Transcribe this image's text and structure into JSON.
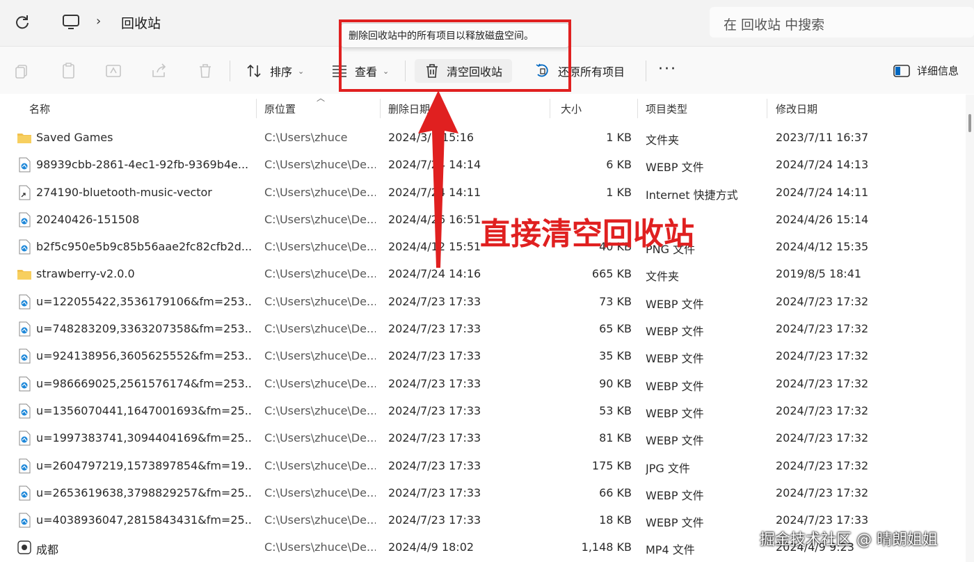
{
  "address": {
    "crumb_sep": "›",
    "crumb": "回收站",
    "search_placeholder": "在 回收站 中搜索"
  },
  "toolbar": {
    "sort_label": "排序",
    "view_label": "查看",
    "empty_label": "清空回收站",
    "restore_all_label": "还原所有项目",
    "more_label": "···",
    "details_label": "详细信息",
    "tooltip": "删除回收站中的所有项目以释放磁盘空间。",
    "caret": "⌄"
  },
  "columns": {
    "name": "名称",
    "location": "原位置",
    "deleted": "删除日期",
    "size": "大小",
    "type": "项目类型",
    "modified": "修改日期"
  },
  "rows": [
    {
      "icon": "folder",
      "name": "Saved Games",
      "location": "C:\\Users\\zhuce",
      "deleted": "2024/3/1 15:16",
      "size": "1 KB",
      "type": "文件夹",
      "modified": "2023/7/11 16:37"
    },
    {
      "icon": "image",
      "name": "98939cbb-2861-4ec1-92fb-9369b4e...",
      "location": "C:\\Users\\zhuce\\De...",
      "deleted": "2024/7/24 14:14",
      "size": "6 KB",
      "type": "WEBP 文件",
      "modified": "2024/7/24 14:13"
    },
    {
      "icon": "shortcut",
      "name": "274190-bluetooth-music-vector",
      "location": "C:\\Users\\zhuce\\De...",
      "deleted": "2024/7/24 14:11",
      "size": "1 KB",
      "type": "Internet 快捷方式",
      "modified": "2024/7/24 14:11"
    },
    {
      "icon": "image",
      "name": "20240426-151508",
      "location": "C:\\Users\\zhuce\\De...",
      "deleted": "2024/4/26 16:51",
      "size": "",
      "type": "",
      "modified": "2024/4/26 15:14"
    },
    {
      "icon": "image",
      "name": "b2f5c950e5b9c85b56aae2fc82cfb2d...",
      "location": "C:\\Users\\zhuce\\De...",
      "deleted": "2024/4/12 15:51",
      "size": "40 KB",
      "type": "PNG 文件",
      "modified": "2024/4/12 15:35"
    },
    {
      "icon": "folder",
      "name": "strawberry-v2.0.0",
      "location": "C:\\Users\\zhuce\\De...",
      "deleted": "2024/7/24 14:16",
      "size": "665 KB",
      "type": "文件夹",
      "modified": "2019/8/5 18:41"
    },
    {
      "icon": "image",
      "name": "u=122055422,3536179106&fm=253...",
      "location": "C:\\Users\\zhuce\\De...",
      "deleted": "2024/7/23 17:33",
      "size": "73 KB",
      "type": "WEBP 文件",
      "modified": "2024/7/23 17:32"
    },
    {
      "icon": "image",
      "name": "u=748283209,3363207358&fm=253...",
      "location": "C:\\Users\\zhuce\\De...",
      "deleted": "2024/7/23 17:33",
      "size": "65 KB",
      "type": "WEBP 文件",
      "modified": "2024/7/23 17:32"
    },
    {
      "icon": "image",
      "name": "u=924138956,3605625552&fm=253...",
      "location": "C:\\Users\\zhuce\\De...",
      "deleted": "2024/7/23 17:33",
      "size": "35 KB",
      "type": "WEBP 文件",
      "modified": "2024/7/23 17:32"
    },
    {
      "icon": "image",
      "name": "u=986669025,2561576174&fm=253...",
      "location": "C:\\Users\\zhuce\\De...",
      "deleted": "2024/7/23 17:33",
      "size": "90 KB",
      "type": "WEBP 文件",
      "modified": "2024/7/23 17:32"
    },
    {
      "icon": "image",
      "name": "u=1356070441,1647001693&fm=25...",
      "location": "C:\\Users\\zhuce\\De...",
      "deleted": "2024/7/23 17:33",
      "size": "53 KB",
      "type": "WEBP 文件",
      "modified": "2024/7/23 17:32"
    },
    {
      "icon": "image",
      "name": "u=1997383741,3094404169&fm=25...",
      "location": "C:\\Users\\zhuce\\De...",
      "deleted": "2024/7/23 17:33",
      "size": "81 KB",
      "type": "WEBP 文件",
      "modified": "2024/7/23 17:32"
    },
    {
      "icon": "image",
      "name": "u=2604797219,1573897854&fm=19...",
      "location": "C:\\Users\\zhuce\\De...",
      "deleted": "2024/7/23 17:33",
      "size": "175 KB",
      "type": "JPG 文件",
      "modified": "2024/7/23 17:32"
    },
    {
      "icon": "image",
      "name": "u=2653619638,3798829257&fm=25...",
      "location": "C:\\Users\\zhuce\\De...",
      "deleted": "2024/7/23 17:33",
      "size": "66 KB",
      "type": "WEBP 文件",
      "modified": "2024/7/23 17:32"
    },
    {
      "icon": "image",
      "name": "u=4038936047,2815843431&fm=25...",
      "location": "C:\\Users\\zhuce\\De...",
      "deleted": "2024/7/23 17:33",
      "size": "18 KB",
      "type": "WEBP 文件",
      "modified": "2024/7/23 17:33"
    },
    {
      "icon": "video",
      "name": "成都",
      "location": "C:\\Users\\zhuce\\De...",
      "deleted": "2024/4/9 18:02",
      "size": "1,148 KB",
      "type": "MP4 文件",
      "modified": "2024/4/9 9:23"
    }
  ],
  "annotation": {
    "text": "直接清空回收站",
    "color": "#e02020"
  },
  "watermark": "掘金技术社区 @ 晴朗姐姐",
  "colors": {
    "accent": "#0067c0",
    "highlight": "#e02020",
    "folder": "#f2c14e"
  }
}
